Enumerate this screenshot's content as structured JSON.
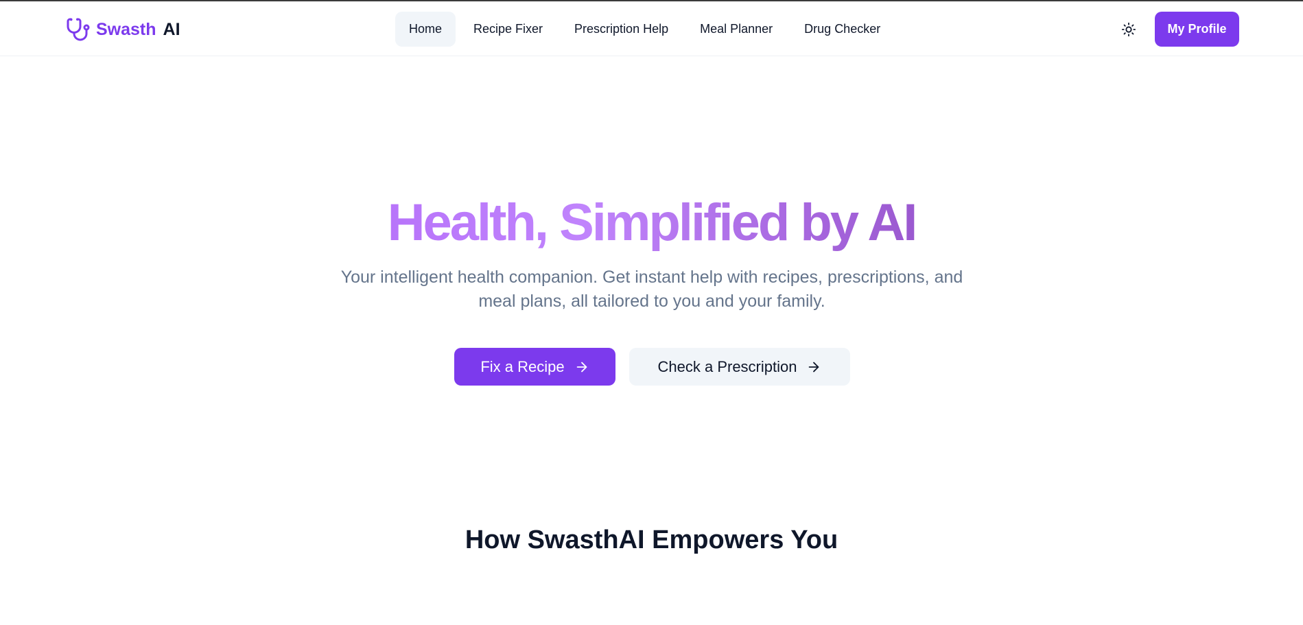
{
  "brand": {
    "name_part1": "Swasth",
    "name_part2": "AI",
    "icon": "stethoscope-icon"
  },
  "nav": {
    "items": [
      {
        "label": "Home",
        "active": true
      },
      {
        "label": "Recipe Fixer",
        "active": false
      },
      {
        "label": "Prescription Help",
        "active": false
      },
      {
        "label": "Meal Planner",
        "active": false
      },
      {
        "label": "Drug Checker",
        "active": false
      }
    ],
    "theme_toggle_icon": "sun-icon",
    "profile_label": "My Profile"
  },
  "hero": {
    "title": "Health, Simplified by AI",
    "subtitle": "Your intelligent health companion. Get instant help with recipes, prescriptions, and meal plans, all tailored to you and your family.",
    "primary_cta": "Fix a Recipe",
    "secondary_cta": "Check a Prescription",
    "cta_icon": "arrow-right-icon"
  },
  "features": {
    "title": "How SwasthAI Empowers You"
  },
  "colors": {
    "accent": "#7c3aed",
    "muted_text": "#64748b",
    "button_secondary_bg": "#f1f5f9"
  }
}
